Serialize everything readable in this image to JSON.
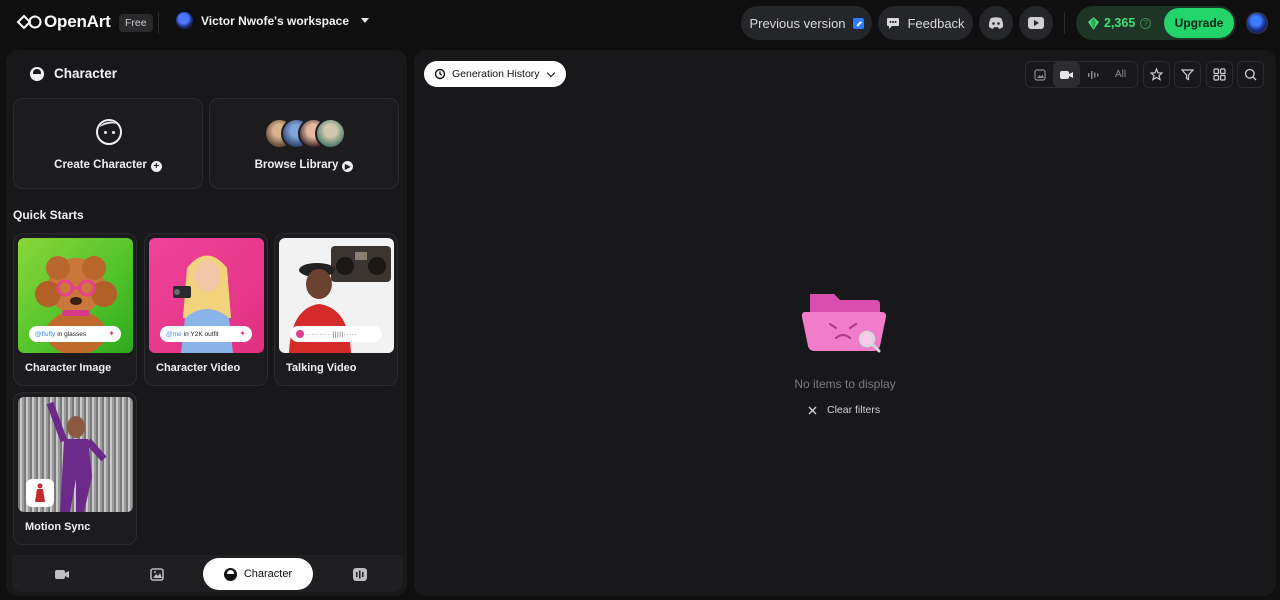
{
  "topbar": {
    "logo_text": "OpenArt",
    "plan_badge": "Free",
    "workspace_name": "Victor Nwofe's workspace",
    "previous_version_label": "Previous version",
    "feedback_label": "Feedback",
    "credits": "2,365",
    "upgrade_label": "Upgrade",
    "icons": [
      "discord-icon",
      "youtube-icon",
      "gem-icon",
      "help-icon"
    ]
  },
  "left_panel": {
    "title": "Character",
    "create_card_label": "Create Character",
    "browse_card_label": "Browse Library",
    "quick_starts_title": "Quick Starts",
    "quick_starts": [
      {
        "label": "Character Image",
        "chip_handle": "@fluffy",
        "chip_text": "in glasses"
      },
      {
        "label": "Character Video",
        "chip_handle": "@me",
        "chip_text": "in Y2K outfit"
      },
      {
        "label": "Talking Video"
      },
      {
        "label": "Motion Sync"
      }
    ],
    "bottom_tabs": [
      {
        "name": "video",
        "label": ""
      },
      {
        "name": "image",
        "label": ""
      },
      {
        "name": "character",
        "label": "Character"
      },
      {
        "name": "audio",
        "label": ""
      }
    ]
  },
  "right_panel": {
    "generation_history_label": "Generation History",
    "filter_all_label": "All",
    "empty_message": "No items to display",
    "clear_filters_label": "Clear filters"
  },
  "colors": {
    "background": "#0f0f10",
    "panel": "#18181a",
    "accent_green": "#22d46a",
    "credits_green": "#3fe07a",
    "empty_folder_pink": "#f06ac6"
  }
}
